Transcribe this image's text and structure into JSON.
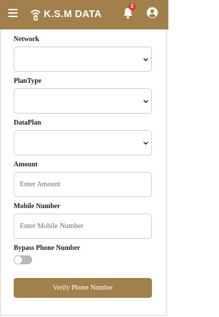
{
  "header": {
    "brand_title": "K.S.M DATA",
    "notification_count": "0",
    "colors": {
      "bar": "#a2804b",
      "badge": "#e02424"
    }
  },
  "form": {
    "network_label": "Network",
    "plantype_label": "PlanType",
    "dataplan_label": "DataPlan",
    "amount_label": "Amount",
    "amount_placeholder": "Enter Amount",
    "mobile_label": "Mobile Number",
    "mobile_placeholder": "Enter Mobile Number",
    "bypass_label": "Bypass Phone Number",
    "bypass_enabled": false,
    "verify_button": "Verify Phone Number"
  },
  "icons": {
    "menu": "menu-icon",
    "logo": "wifi-logo-icon",
    "bell": "bell-icon",
    "user": "user-icon",
    "chevron": "chevron-down-icon"
  }
}
